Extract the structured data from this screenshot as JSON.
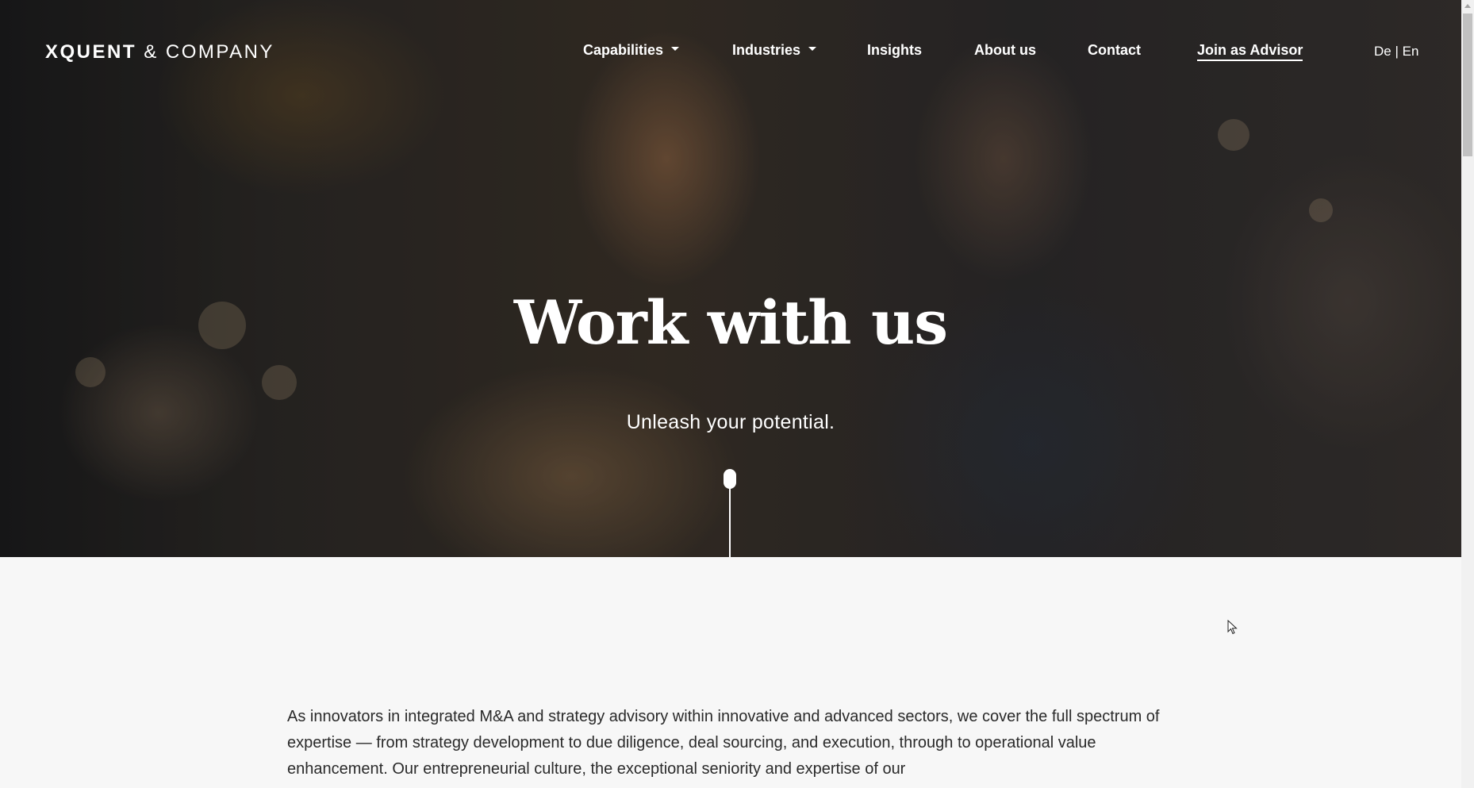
{
  "brand": {
    "logo_bold": "XQUENT",
    "logo_rest": "& COMPANY"
  },
  "nav": {
    "items": [
      {
        "label": "Capabilities",
        "has_dropdown": true
      },
      {
        "label": "Industries",
        "has_dropdown": true
      },
      {
        "label": "Insights",
        "has_dropdown": false
      },
      {
        "label": "About us",
        "has_dropdown": false
      },
      {
        "label": "Contact",
        "has_dropdown": false
      },
      {
        "label": "Join as Advisor",
        "has_dropdown": false
      }
    ],
    "language": {
      "de": "De",
      "separator": "|",
      "en": "En"
    }
  },
  "hero": {
    "title": "Work with us",
    "subtitle": "Unleash your potential.",
    "scroll_indicator_icon": "scroll-down-icon"
  },
  "intro": {
    "text": "As innovators in integrated M&A and strategy advisory within innovative and advanced sectors, we cover the full spectrum of expertise — from strategy development to due diligence, deal sourcing, and execution, through to operational value enhancement. Our entrepreneurial culture, the exceptional seniority and expertise of our"
  },
  "colors": {
    "nav_text": "#ffffff",
    "page_background": "#f7f7f7",
    "body_text": "#2a2a2a"
  }
}
